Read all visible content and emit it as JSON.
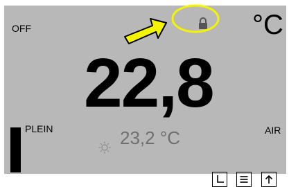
{
  "status": {
    "mode": "OFF",
    "unit": "°C"
  },
  "temperature": {
    "current": "22,8",
    "setpoint": "23,2 °C"
  },
  "level": {
    "label": "PLEIN",
    "fill_percent": 100
  },
  "air_label": "AIR",
  "icons": {
    "lock": "lock-icon",
    "sun": "sun-icon",
    "clock": "clock-icon",
    "menu": "menu-icon",
    "up": "arrow-up-icon"
  },
  "colors": {
    "background": "#b8b8b8",
    "setpoint_text": "#6f6f6f",
    "annotation_highlight": "#f4f400"
  }
}
